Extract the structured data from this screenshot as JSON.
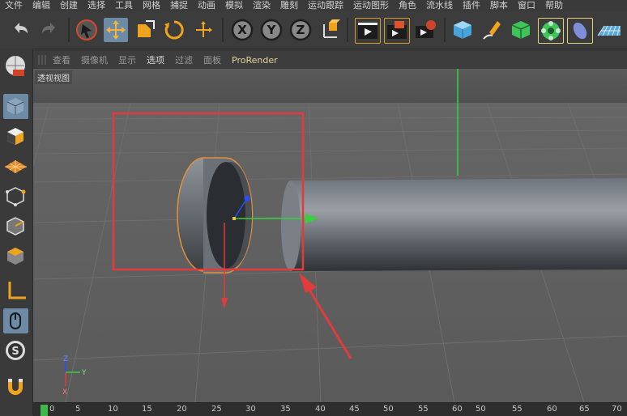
{
  "menu": [
    "文件",
    "编辑",
    "创建",
    "选择",
    "工具",
    "网格",
    "捕捉",
    "动画",
    "模拟",
    "渲染",
    "雕刻",
    "运动跟踪",
    "运动图形",
    "角色",
    "流水线",
    "插件",
    "脚本",
    "窗口",
    "帮助"
  ],
  "toolbar_icons": [
    "undo-icon",
    "redo-icon",
    "live-selection-icon",
    "move-icon",
    "scale-icon",
    "rotate-icon",
    "last-tool-icon",
    "x-axis-lock-icon",
    "y-axis-lock-icon",
    "z-axis-lock-icon",
    "coordinate-system-icon",
    "render-view-icon",
    "render-to-picture-viewer-icon",
    "render-settings-icon",
    "cube-icon",
    "pen-icon",
    "subdivision-icon",
    "cloner-icon",
    "deformer-icon",
    "floor-icon"
  ],
  "axis_labels": {
    "x": "X",
    "y": "Y",
    "z": "Z"
  },
  "viewport": {
    "tabs": [
      "查看",
      "摄像机",
      "显示",
      "选项",
      "过滤",
      "面板",
      "ProRender"
    ],
    "selected_tab": "选项",
    "title": "透视视图",
    "axis_gizmo": {
      "x": "X",
      "y": "Y",
      "z": "Z"
    }
  },
  "left_palette_icons": [
    "make-editable-icon",
    "texture-mode-icon",
    "workplane-icon",
    "points-mode-icon",
    "edges-mode-icon",
    "polygons-mode-icon",
    "axis-mode-icon",
    "tweak-mode-icon",
    "snap-icon",
    "magnet-icon"
  ],
  "timeline": {
    "ticks": [
      "0",
      "5",
      "10",
      "15",
      "20",
      "25",
      "30",
      "35",
      "40",
      "45",
      "50",
      "55",
      "60",
      "50",
      "55",
      "60",
      "65",
      "70"
    ],
    "current_frame": "0"
  },
  "colors": {
    "selection_box": "#e23b3b",
    "arrow": "#e23b3b",
    "axis_x": "#e23b3b",
    "axis_y": "#35d23a",
    "axis_z": "#2a4cff",
    "active_button": "#6d8aa6",
    "object_outline": "#e0923a"
  }
}
